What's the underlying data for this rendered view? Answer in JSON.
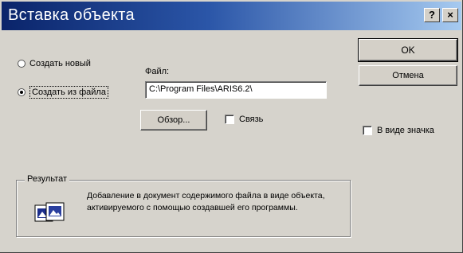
{
  "window": {
    "title": "Вставка объекта",
    "help_glyph": "?",
    "close_glyph": "×"
  },
  "buttons": {
    "ok": "OK",
    "cancel": "Отмена",
    "browse": "Обзор..."
  },
  "options": {
    "create_new": "Создать новый",
    "create_from_file": "Создать из файла",
    "selected": "create_from_file"
  },
  "file": {
    "label": "Файл:",
    "value": "C:\\Program Files\\ARIS6.2\\"
  },
  "checkboxes": {
    "link": {
      "label": "Связь",
      "checked": false
    },
    "as_icon": {
      "label": "В виде значка",
      "checked": false
    }
  },
  "result": {
    "label": "Результат",
    "text": "Добавление в документ содержимого файла в виде объекта, активируемого с помощью создавшей его программы."
  }
}
